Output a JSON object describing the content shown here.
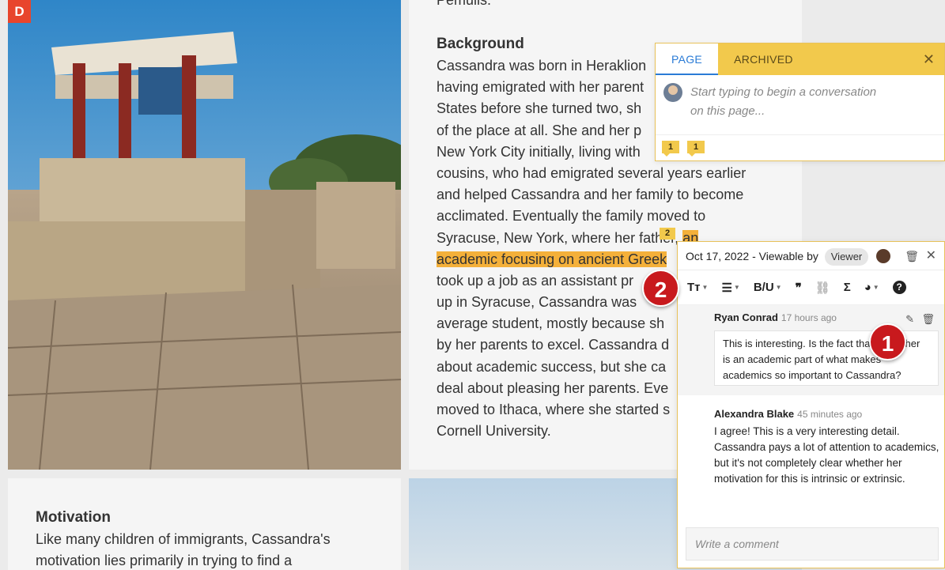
{
  "app": {
    "logo_letter": "D"
  },
  "document": {
    "prev_tail": "Pemulis.",
    "background_heading": "Background",
    "background_lines": [
      "Cassandra was born in Heraklion",
      "having emigrated with her parent",
      "States before she turned two, sh",
      "of the place at all. She and her p",
      "New York City initially, living with",
      "cousins, who had emigrated several years earlier",
      "and helped Cassandra and her family to become",
      "acclimated. Eventually the family moved to",
      "Syracuse, New York, where her father",
      "took up a job as an assistant pr",
      "up in Syracuse, Cassandra was",
      "average student, mostly because sh",
      "by her parents to excel. Cassandra d",
      "about academic success, but she ca",
      "deal about pleasing her parents. Eve",
      "moved to Ithaca, where she started s",
      "Cornell University."
    ],
    "highlight_part1": "an",
    "highlight_line2": "academic focusing on ancient Greek",
    "motivation_heading": "Motivation",
    "motivation_lines": [
      "Like many children of immigrants, Cassandra's",
      "motivation lies primarily in trying to find a"
    ]
  },
  "page_panel": {
    "tabs": [
      "PAGE",
      "ARCHIVED"
    ],
    "active_tab": "PAGE",
    "placeholder_line1": "Start typing to begin a conversation",
    "placeholder_line2": "on this page...",
    "badges": [
      "1",
      "1"
    ]
  },
  "marker": "2",
  "comment_panel": {
    "date": "Oct 17, 2022",
    "viewable_by": "- Viewable by",
    "viewer_label": "Viewer",
    "toolbar": {
      "text_style": "Tт",
      "list": "☰",
      "bold_underline": "B/U",
      "quote": "❞",
      "link": "🔗",
      "sigma": "Σ",
      "palette": "🎨",
      "help": "?"
    },
    "comments": [
      {
        "author": "Ryan Conrad",
        "time": "17 hours ago",
        "text": "This is interesting. Is the fact that her father is an academic part of what makes academics so important to Cassandra?"
      },
      {
        "author": "Alexandra Blake",
        "time": "45 minutes ago",
        "text": "I agree! This is a very interesting detail. Cassandra pays a lot of attention to academics, but it's not completely clear whether her motivation for this is intrinsic or extrinsic."
      }
    ],
    "write_placeholder": "Write a comment"
  },
  "callouts": [
    "1",
    "2"
  ],
  "colors": {
    "highlight": "#f4b03a",
    "panel_accent": "#f2c94c",
    "active_tab": "#2a7bd6",
    "callout": "#c8191d"
  }
}
